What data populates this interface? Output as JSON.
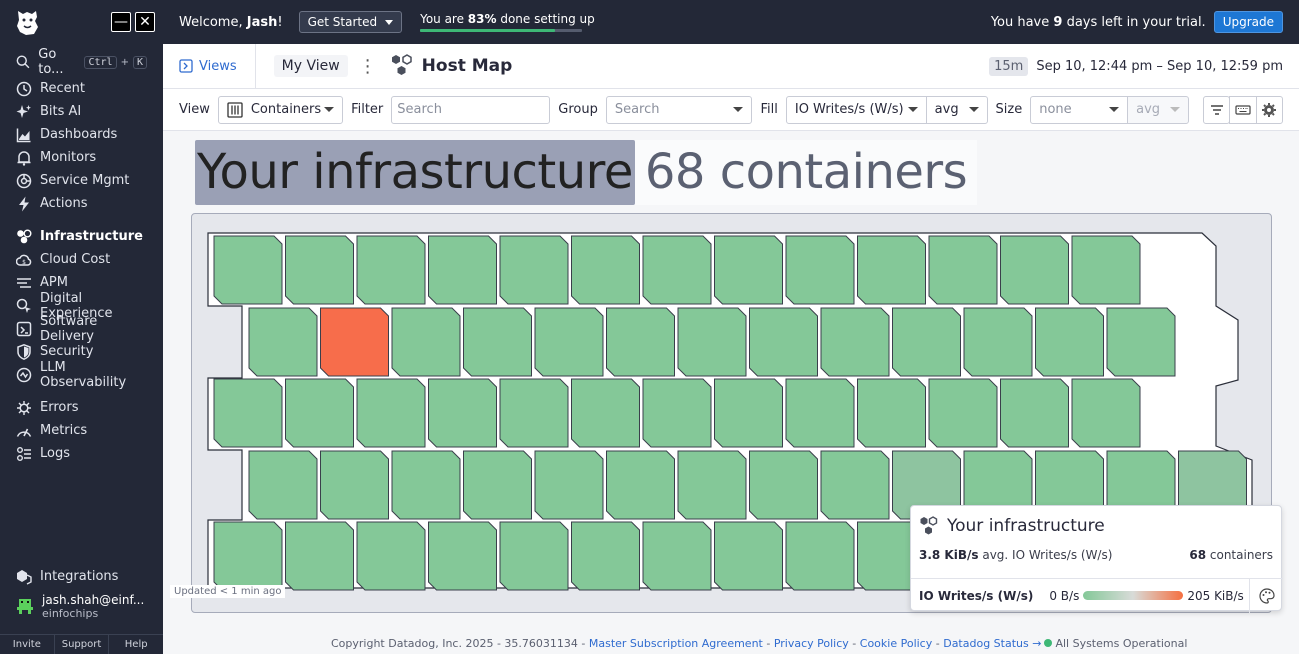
{
  "topbar": {
    "welcome_prefix": "Welcome, ",
    "user_first": "Jash",
    "welcome_suffix": "!",
    "get_started": "Get Started",
    "setup_prefix": "You are ",
    "setup_pct": "83%",
    "setup_suffix": " done setting up",
    "setup_progress": 0.83,
    "trial_prefix": "You have ",
    "trial_days": "9",
    "trial_suffix": " days left in your trial.",
    "upgrade": "Upgrade"
  },
  "sidebar": {
    "goto_label": "Go to...",
    "goto_key1": "Ctrl",
    "goto_plus": "+",
    "goto_key2": "K",
    "group1": [
      {
        "label": "Recent",
        "icon": "clock-icon"
      },
      {
        "label": "Bits AI",
        "icon": "sparkle-icon"
      },
      {
        "label": "Dashboards",
        "icon": "chart-icon"
      },
      {
        "label": "Monitors",
        "icon": "bell-icon"
      },
      {
        "label": "Service Mgmt",
        "icon": "service-icon"
      },
      {
        "label": "Actions",
        "icon": "bolt-icon"
      }
    ],
    "group2": [
      {
        "label": "Infrastructure",
        "icon": "hexagons-icon"
      },
      {
        "label": "Cloud Cost",
        "icon": "cloud-icon"
      },
      {
        "label": "APM",
        "icon": "apm-icon"
      },
      {
        "label": "Digital Experience",
        "icon": "experience-icon"
      },
      {
        "label": "Software Delivery",
        "icon": "delivery-icon"
      },
      {
        "label": "Security",
        "icon": "shield-icon"
      },
      {
        "label": "LLM Observability",
        "icon": "llm-icon"
      }
    ],
    "group3": [
      {
        "label": "Errors",
        "icon": "bug-icon"
      },
      {
        "label": "Metrics",
        "icon": "metrics-icon"
      },
      {
        "label": "Logs",
        "icon": "logs-icon"
      }
    ],
    "integrations": "Integrations",
    "user_email": "jash.shah@einf...",
    "user_org": "einfochips",
    "footer": [
      "Invite",
      "Support",
      "Help"
    ]
  },
  "header": {
    "views": "Views",
    "my_view": "My View",
    "title": "Host Map",
    "time_badge": "15m",
    "time_range": "Sep 10, 12:44 pm – Sep 10, 12:59 pm"
  },
  "controls": {
    "view_label": "View",
    "view_value": "Containers",
    "filter_label": "Filter",
    "filter_placeholder": "Search",
    "group_label": "Group",
    "group_placeholder": "Search",
    "fill_label": "Fill",
    "fill_metric": "IO Writes/s (W/s)",
    "fill_agg": "avg",
    "size_label": "Size",
    "size_metric": "none",
    "size_agg": "avg"
  },
  "map": {
    "title": "Your infrastructure",
    "count_text": "68 containers",
    "updated": "Updated < 1 min ago",
    "rows": [
      13,
      13,
      13,
      14,
      15
    ],
    "hot_cell": {
      "row": 1,
      "col": 1
    },
    "faded_cells": [
      {
        "row": 3,
        "col": 9
      },
      {
        "row": 3,
        "col": 13
      }
    ],
    "colors": {
      "normal": "#84c898",
      "faded": "#8ec4a0",
      "hot": "#f76d4b"
    }
  },
  "legend": {
    "title": "Your infrastructure",
    "avg_value": "3.8 KiB/s",
    "avg_label": " avg. IO Writes/s (W/s)",
    "count_value": "68",
    "count_label": " containers",
    "metric": "IO Writes/s (W/s)",
    "min": "0 B/s",
    "max": "205 KiB/s"
  },
  "footer": {
    "copyright": "Copyright Datadog, Inc. 2025 - 35.76031134 - ",
    "links": [
      "Master Subscription Agreement",
      "Privacy Policy",
      "Cookie Policy",
      "Datadog Status →"
    ],
    "sep": " - ",
    "status": "All Systems Operational"
  }
}
